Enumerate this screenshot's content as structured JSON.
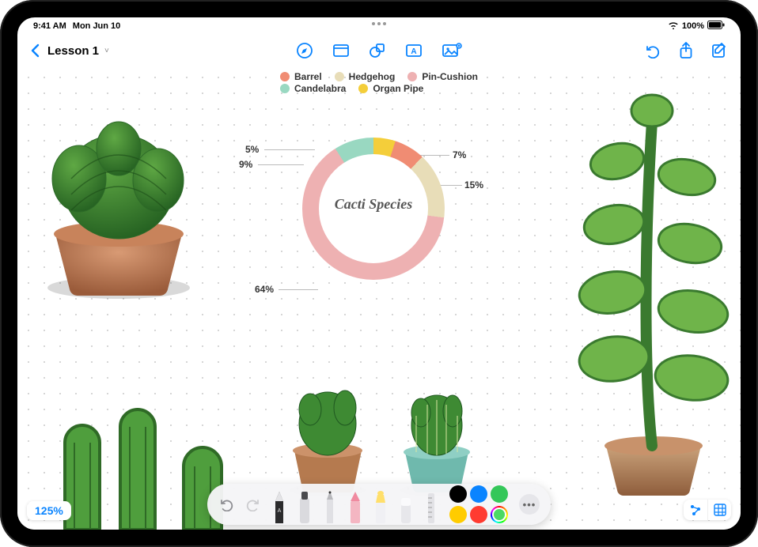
{
  "status": {
    "time": "9:41 AM",
    "date": "Mon Jun 10",
    "battery": "100%"
  },
  "header": {
    "back": "‹",
    "title": "Lesson 1"
  },
  "toolbar": {
    "draw": "draw",
    "note": "note",
    "shape": "shape",
    "text": "text",
    "media": "media",
    "undo": "undo",
    "share": "share",
    "compose": "compose"
  },
  "chart_data": {
    "type": "pie",
    "title": "Cacti Species",
    "series": [
      {
        "name": "Barrel",
        "value": 7,
        "color": "#f08c73"
      },
      {
        "name": "Hedgehog",
        "value": 15,
        "color": "#e8ddb8"
      },
      {
        "name": "Pin-Cushion",
        "value": 64,
        "color": "#eeb1b2"
      },
      {
        "name": "Candelabra",
        "value": 9,
        "color": "#99d8c1"
      },
      {
        "name": "Organ Pipe",
        "value": 5,
        "color": "#f4ce3a"
      }
    ],
    "labels": {
      "pct_7": "7%",
      "pct_15": "15%",
      "pct_64": "64%",
      "pct_9": "9%",
      "pct_5": "5%"
    }
  },
  "legend_rows": [
    [
      "Barrel",
      "Hedgehog",
      "Pin-Cushion"
    ],
    [
      "Candelabra",
      "Organ Pipe"
    ]
  ],
  "zoom": "125%",
  "tools": {
    "undo": "↶",
    "redo": "↷",
    "colors": {
      "black": "#000",
      "blue": "#0a84ff",
      "green": "#34c759",
      "yellow": "#ffcc00",
      "red": "#ff3b30"
    }
  }
}
